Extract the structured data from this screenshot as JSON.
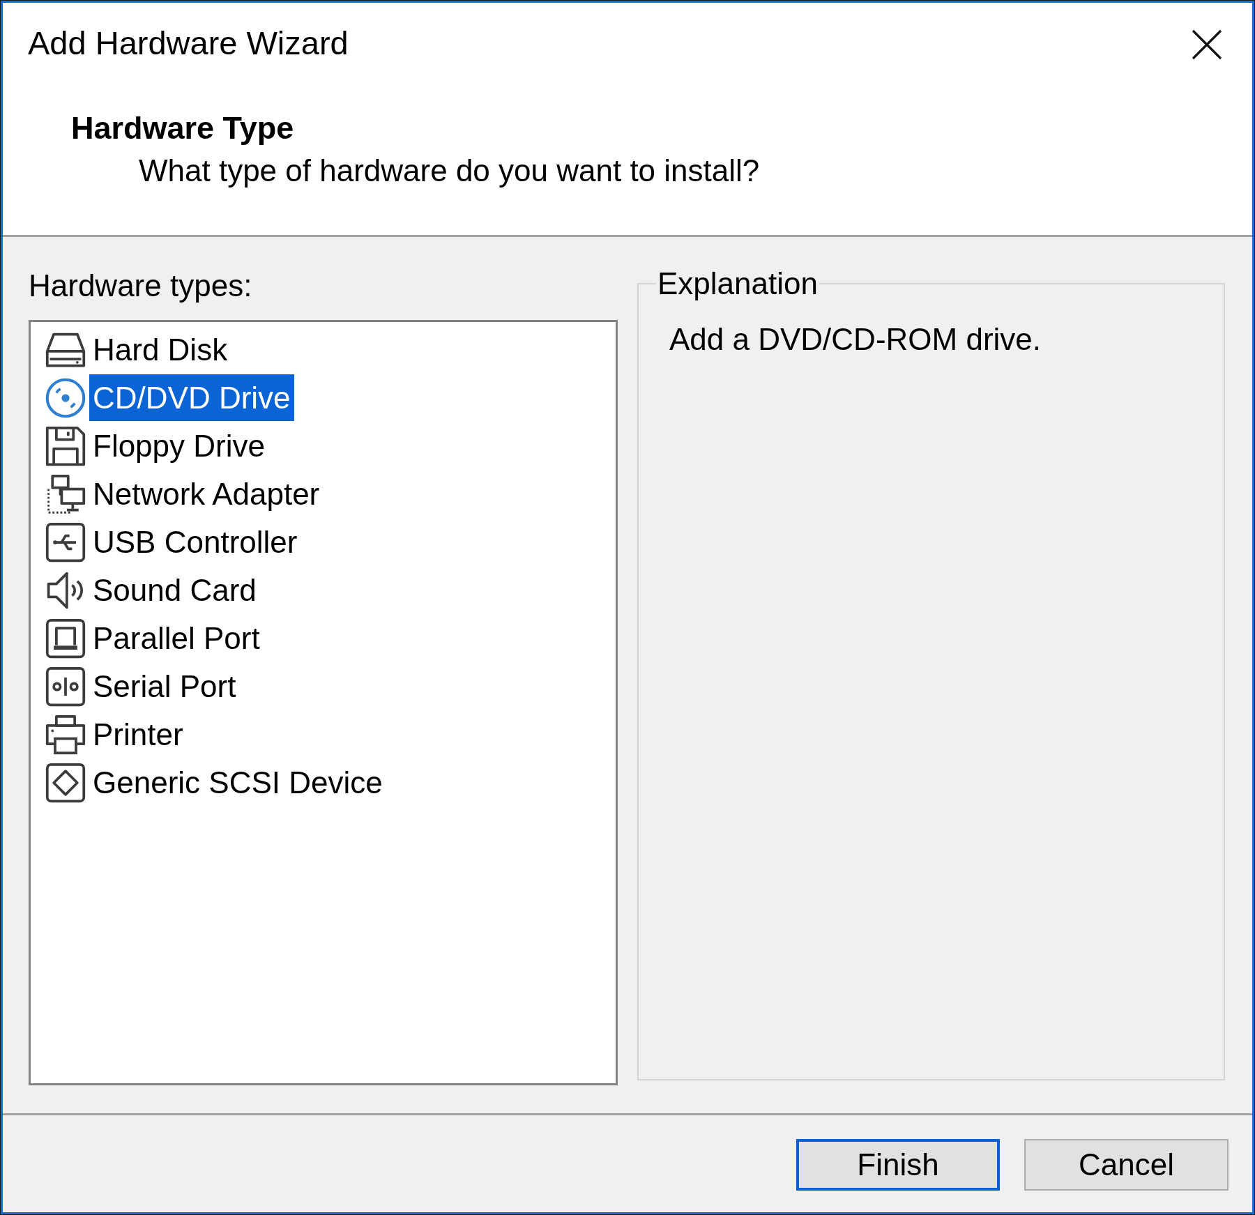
{
  "window": {
    "title": "Add Hardware Wizard"
  },
  "header": {
    "title": "Hardware Type",
    "subtitle": "What type of hardware do you want to install?"
  },
  "hardware_types": {
    "label": "Hardware types:",
    "items": [
      {
        "label": "Hard Disk",
        "kind": "hard-disk",
        "selected": false
      },
      {
        "label": "CD/DVD Drive",
        "kind": "disc",
        "selected": true
      },
      {
        "label": "Floppy Drive",
        "kind": "floppy",
        "selected": false
      },
      {
        "label": "Network Adapter",
        "kind": "network",
        "selected": false
      },
      {
        "label": "USB Controller",
        "kind": "usb",
        "selected": false
      },
      {
        "label": "Sound Card",
        "kind": "sound",
        "selected": false
      },
      {
        "label": "Parallel Port",
        "kind": "parallel",
        "selected": false
      },
      {
        "label": "Serial Port",
        "kind": "serial",
        "selected": false
      },
      {
        "label": "Printer",
        "kind": "printer",
        "selected": false
      },
      {
        "label": "Generic SCSI Device",
        "kind": "scsi",
        "selected": false
      }
    ]
  },
  "explanation": {
    "legend": "Explanation",
    "text": "Add a DVD/CD-ROM drive."
  },
  "buttons": [
    {
      "label": "Finish",
      "default": true
    },
    {
      "label": "Cancel",
      "default": false
    }
  ]
}
